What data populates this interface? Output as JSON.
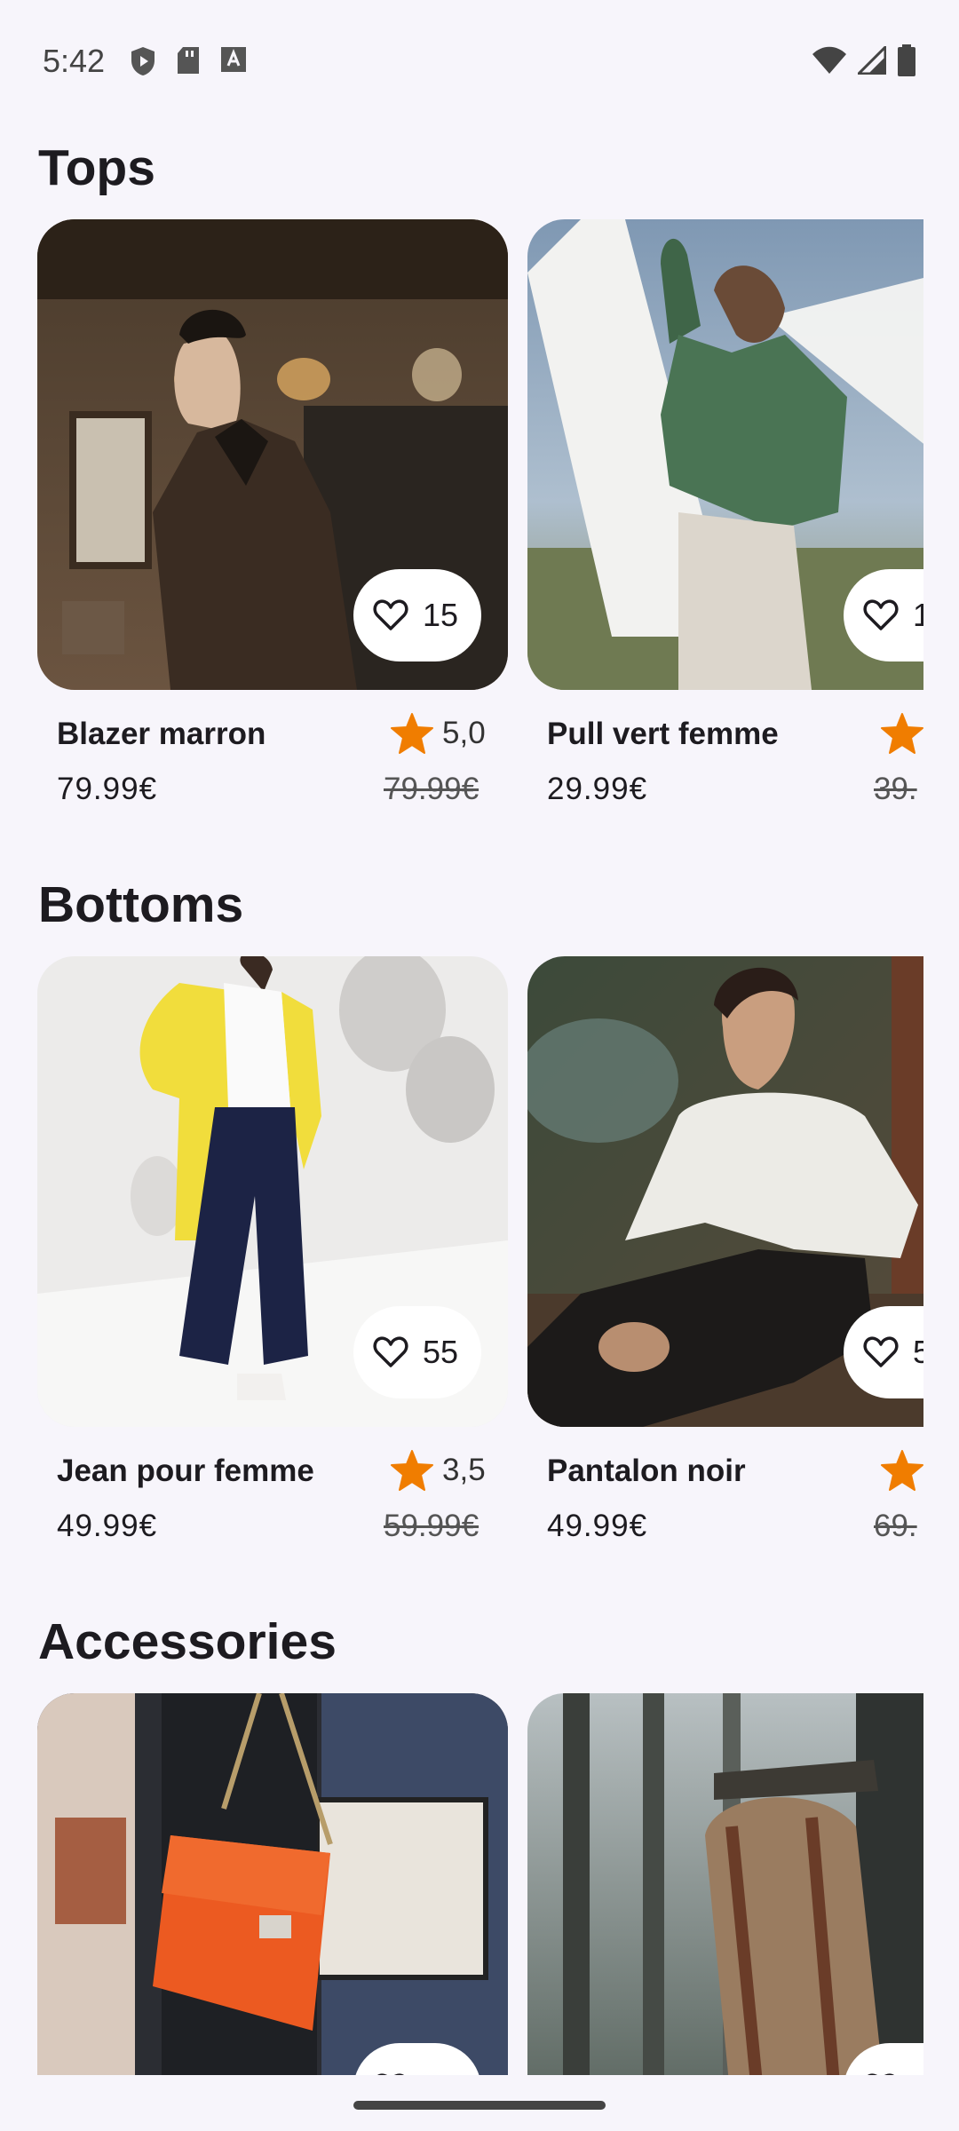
{
  "status": {
    "time": "5:42",
    "icons_left": [
      "shield-play-icon",
      "sd-card-icon",
      "keyboard-a-icon"
    ],
    "icons_right": [
      "wifi-icon",
      "signal-icon",
      "battery-icon"
    ]
  },
  "colors": {
    "accent_star": "#f07d00",
    "background": "#f7f5fb"
  },
  "sections": [
    {
      "title": "Tops",
      "items": [
        {
          "name": "Blazer marron",
          "price": "79.99€",
          "old_price": "79.99€",
          "rating": "5,0",
          "likes": "15"
        },
        {
          "name": "Pull vert femme",
          "price": "29.99€",
          "old_price": "39.",
          "rating": "",
          "likes": "1"
        }
      ]
    },
    {
      "title": "Bottoms",
      "items": [
        {
          "name": "Jean pour femme",
          "price": "49.99€",
          "old_price": "59.99€",
          "rating": "3,5",
          "likes": "55"
        },
        {
          "name": "Pantalon noir",
          "price": "49.99€",
          "old_price": "69.",
          "rating": "",
          "likes": "5"
        }
      ]
    },
    {
      "title": "Accessories",
      "items": [
        {
          "likes": ""
        },
        {
          "likes": ""
        }
      ]
    }
  ]
}
